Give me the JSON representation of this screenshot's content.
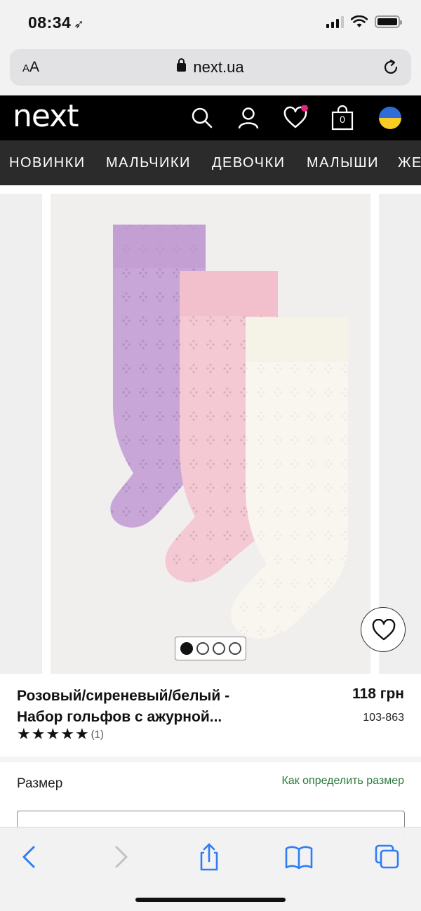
{
  "status_bar": {
    "time": "08:34",
    "location_arrow": "location-arrow-icon"
  },
  "browser": {
    "text_size_label_small": "A",
    "text_size_label_large": "A",
    "url": "next.ua"
  },
  "header": {
    "logo": "next",
    "bag_count": "0",
    "icons": [
      "search-icon",
      "account-icon",
      "wishlist-heart-icon",
      "shopping-bag-icon",
      "ukraine-flag-icon"
    ],
    "wishlist_dot_color": "#e0267d"
  },
  "nav": {
    "items": [
      "НОВИНКИ",
      "МАЛЬЧИКИ",
      "ДЕВОЧКИ",
      "МАЛЫШИ",
      "ЖЕ"
    ]
  },
  "gallery": {
    "total_images": 4,
    "active_index": 0
  },
  "product": {
    "title": "Розовый/сиреневый/белый - Набор гольфов с ажурной...",
    "price": "118 грн",
    "code": "103-863",
    "rating_stars": 5,
    "rating_count": "(1)"
  },
  "size": {
    "label": "Размер",
    "guide_link": "Как определить размер"
  },
  "colors": {
    "accent_green": "#2c7a3c",
    "ios_blue": "#2f7cf6",
    "sock_lilac": "#c9a6d8",
    "sock_pink": "#f4c9d4",
    "sock_white": "#f8f6ee"
  }
}
